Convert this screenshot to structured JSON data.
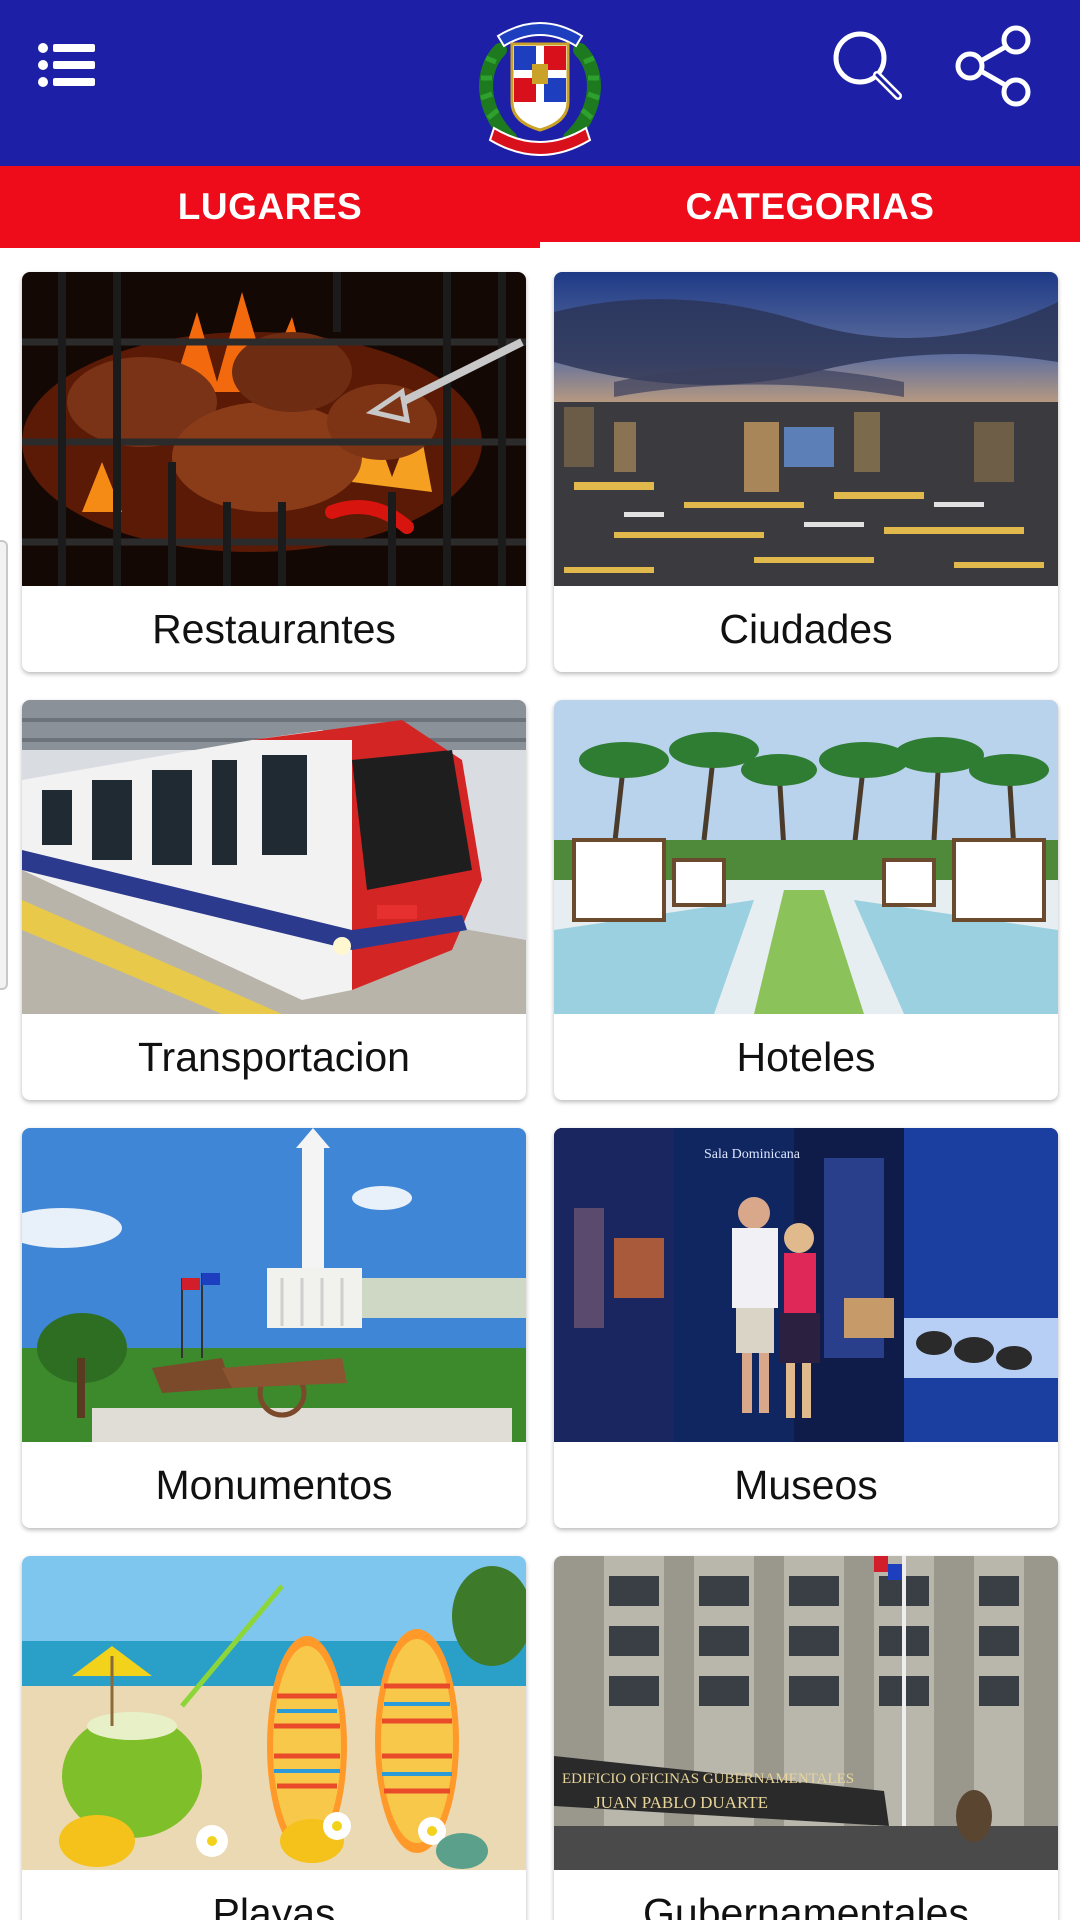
{
  "app": {
    "colors": {
      "primary": "#1d1fa6",
      "accent": "#ee0c1b",
      "surface": "#ffffff",
      "text": "#111111"
    }
  },
  "toolbar": {
    "menu_icon": "menu-list-icon",
    "logo": "dominican-republic-coat-of-arms",
    "search_icon": "search-icon",
    "share_icon": "share-icon"
  },
  "tabs": [
    {
      "label": "LUGARES",
      "selected": false
    },
    {
      "label": "CATEGORIAS",
      "selected": true
    }
  ],
  "categories": [
    {
      "label": "Restaurantes",
      "image": "grilled-meat-photo"
    },
    {
      "label": "Ciudades",
      "image": "city-night-skyline-photo"
    },
    {
      "label": "Transportacion",
      "image": "metro-train-photo"
    },
    {
      "label": "Hoteles",
      "image": "resort-palm-garden-photo"
    },
    {
      "label": "Monumentos",
      "image": "monument-statue-photo"
    },
    {
      "label": "Museos",
      "image": "museum-exhibit-photo"
    },
    {
      "label": "Playas",
      "image": "beach-sandals-coconut-photo"
    },
    {
      "label": "Gubernamentales",
      "image": "government-building-photo"
    }
  ],
  "photo_captions": {
    "government_sign_line1": "EDIFICIO OFICINAS GUBERNAMENTALES",
    "government_sign_line2": "JUAN PABLO DUARTE",
    "museum_sign": "Sala Dominicana"
  }
}
